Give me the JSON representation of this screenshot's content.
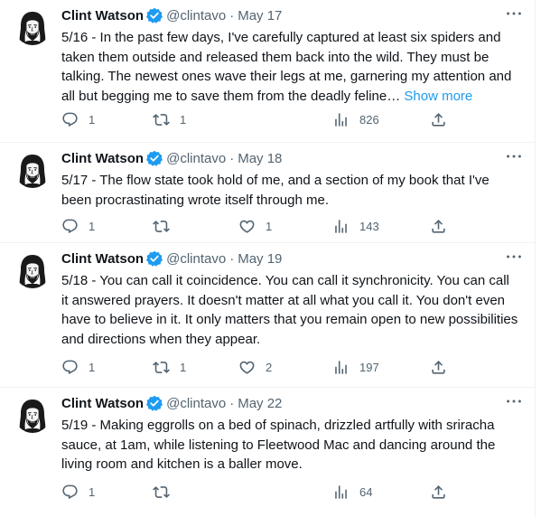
{
  "tweets": [
    {
      "name": "Clint Watson",
      "handle": "@clintavo",
      "separator": "·",
      "date": "May 17",
      "text": "5/16 - In the past few days, I've carefully captured at least six spiders and taken them outside and released them back into the wild.  They must be talking.  The newest ones wave their legs at me, garnering my attention and all but begging me to save them from the deadly feline… ",
      "show_more": "Show more",
      "replies": "1",
      "retweets": "1",
      "likes": "",
      "views": "826"
    },
    {
      "name": "Clint Watson",
      "handle": "@clintavo",
      "separator": "·",
      "date": "May 18",
      "text": "5/17 - The flow state took hold of me, and a section of my book that I've been procrastinating wrote itself through me.",
      "show_more": "",
      "replies": "1",
      "retweets": "",
      "likes": "1",
      "views": "143"
    },
    {
      "name": "Clint Watson",
      "handle": "@clintavo",
      "separator": "·",
      "date": "May 19",
      "text": "5/18 - You can call it coincidence.  You can call it synchronicity.  You can call it answered prayers.  It doesn't matter at all what you call it. You don't even have to believe in it.  It only matters that you remain open to new possibilities and directions when they appear.",
      "show_more": "",
      "replies": "1",
      "retweets": "1",
      "likes": "2",
      "views": "197"
    },
    {
      "name": "Clint Watson",
      "handle": "@clintavo",
      "separator": "·",
      "date": "May 22",
      "text": "5/19 - Making eggrolls on a bed of spinach, drizzled artfully with sriracha sauce, at 1am, while listening to Fleetwood Mac and dancing around the living room and kitchen is a baller move.",
      "show_more": "",
      "replies": "1",
      "retweets": "",
      "likes": "",
      "views": "64"
    }
  ],
  "colors": {
    "text": "#0f1419",
    "secondary": "#536471",
    "link": "#1d9bf0",
    "verified": "#1d9bf0",
    "divider": "#eff3f4"
  },
  "icons": {
    "reply": "reply-icon",
    "retweet": "retweet-icon",
    "like": "heart-icon",
    "views": "views-icon",
    "share": "share-icon",
    "more": "more-dots-icon",
    "verified": "verified-badge-icon"
  }
}
